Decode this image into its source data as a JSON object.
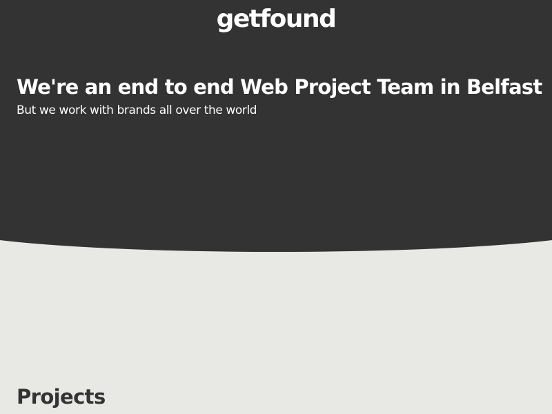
{
  "header": {
    "logo_text": "getfound"
  },
  "hero": {
    "headline": "We're an end to end Web Project Team in Belfast",
    "subheadline": "But we work with brands all over the world"
  },
  "sections": {
    "projects_heading": "Projects"
  },
  "colors": {
    "hero_background": "#333333",
    "page_background": "#e8e8e4",
    "hero_text": "#ffffff",
    "heading_text": "#333333"
  }
}
